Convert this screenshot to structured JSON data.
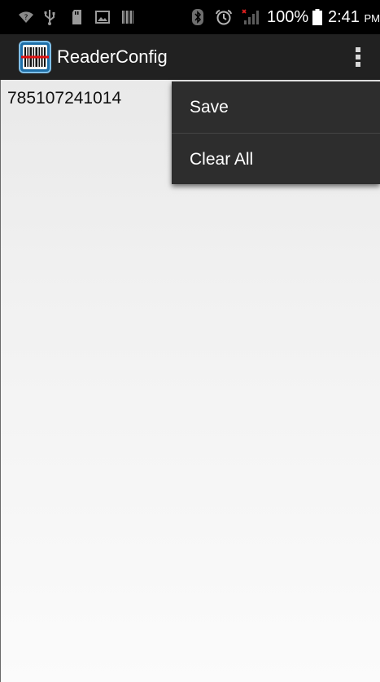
{
  "status_bar": {
    "battery_percent": "100%",
    "battery_level": 1.0,
    "time": "2:41",
    "ampm": "PM",
    "icons": [
      "wifi-icon",
      "usb-icon",
      "sd-card-icon",
      "image-icon",
      "barcode-icon",
      "bluetooth-icon",
      "alarm-icon",
      "signal-icon",
      "battery-icon"
    ]
  },
  "action_bar": {
    "title": "ReaderConfig",
    "app_icon": "barcode-scanner-icon",
    "overflow_icon": "more-vert-icon"
  },
  "content": {
    "scan_result": "785107241014"
  },
  "overflow_menu": {
    "items": [
      {
        "label": "Save"
      },
      {
        "label": "Clear All"
      }
    ]
  },
  "colors": {
    "status_bar": "#000000",
    "action_bar": "#212121",
    "menu_background": "#2d2d2d",
    "scanner_accent": "#e01010"
  }
}
